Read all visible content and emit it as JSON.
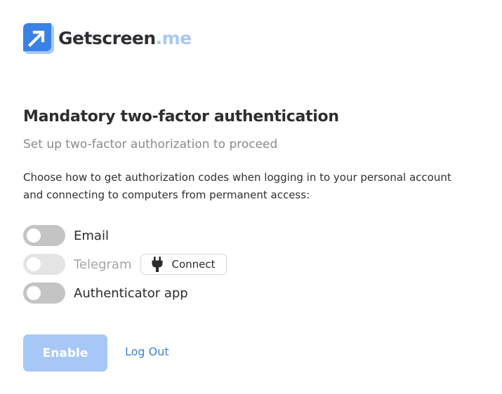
{
  "logo": {
    "brand": "Getscreen",
    "tld": ".me",
    "icon": "arrow-up-right-icon",
    "colors": {
      "primary": "#3b82e6",
      "light": "#a9c8f5"
    }
  },
  "heading": {
    "title": "Mandatory two-factor authentication",
    "subtitle": "Set up two-factor authorization to proceed"
  },
  "description": "Choose how to get authorization codes when logging in to your personal account and connecting to computers from permanent access:",
  "methods": [
    {
      "label": "Email",
      "enabled": false,
      "disabled": false
    },
    {
      "label": "Telegram",
      "enabled": false,
      "disabled": true,
      "connect_label": "Connect",
      "connect_icon": "plug-icon"
    },
    {
      "label": "Authenticator app",
      "enabled": false,
      "disabled": false
    }
  ],
  "actions": {
    "enable_label": "Enable",
    "logout_label": "Log Out"
  },
  "colors": {
    "accent": "#3e82d8",
    "button_disabled": "#a7c8f6",
    "toggle_off": "#c4c4c4",
    "toggle_disabled": "#e4e4e4"
  }
}
